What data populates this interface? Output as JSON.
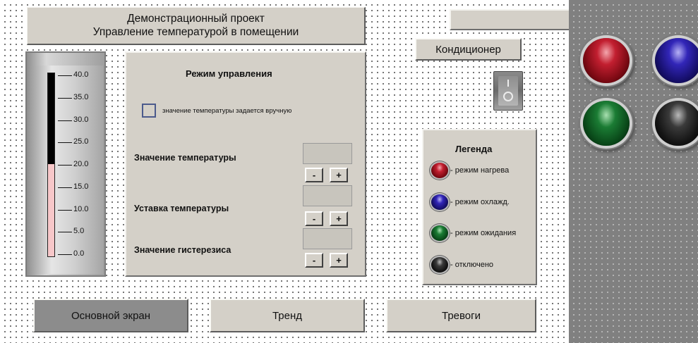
{
  "header": {
    "title_line1": "Демонстрационный проект",
    "title_line2": "Управление температурой в помещении"
  },
  "thermometer": {
    "value": 20.0,
    "scale_min": 0.0,
    "scale_max": 40.0,
    "ticks": [
      "40.0",
      "35.0",
      "30.0",
      "25.0",
      "20.0",
      "15.0",
      "10.0",
      "5.0",
      "0.0"
    ],
    "fill_color": "#f7c7c9",
    "empty_color": "#000000"
  },
  "control_mode": {
    "heading": "Режим управления",
    "checkbox_label": "значение температуры задается вручную",
    "checkbox_checked": false,
    "rows": [
      {
        "label": "Значение температуры",
        "value": "",
        "minus": "-",
        "plus": "+"
      },
      {
        "label": "Уставка температуры",
        "value": "",
        "minus": "-",
        "plus": "+"
      },
      {
        "label": "Значение гистерезиса",
        "value": "",
        "minus": "-",
        "plus": "+"
      }
    ]
  },
  "top_field": {
    "value": ""
  },
  "conditioner": {
    "label": "Кондиционер",
    "switch_state": "off",
    "switch_icon": "toggle-switch-icon"
  },
  "legend": {
    "heading": "Легенда",
    "items": [
      {
        "color": "red",
        "icon": "red-led-icon",
        "text": "- режим нагрева"
      },
      {
        "color": "blue",
        "icon": "blue-led-icon",
        "text": "- режим охлажд."
      },
      {
        "color": "green",
        "icon": "green-led-icon",
        "text": "- режим ожидания"
      },
      {
        "color": "black",
        "icon": "black-led-icon",
        "text": "- отключено"
      }
    ]
  },
  "indicators": [
    {
      "color": "red",
      "icon": "red-led-icon"
    },
    {
      "color": "blue",
      "icon": "blue-led-icon"
    },
    {
      "color": "green",
      "icon": "green-led-icon"
    },
    {
      "color": "black",
      "icon": "black-led-icon"
    }
  ],
  "nav": {
    "main_label": "Основной экран",
    "trend_label": "Тренд",
    "alarms_label": "Тревоги",
    "active": "main"
  },
  "colors": {
    "panel_bg": "#d4d0c8",
    "side_panel_bg": "#808080",
    "active_button": "#8c8c8c"
  }
}
